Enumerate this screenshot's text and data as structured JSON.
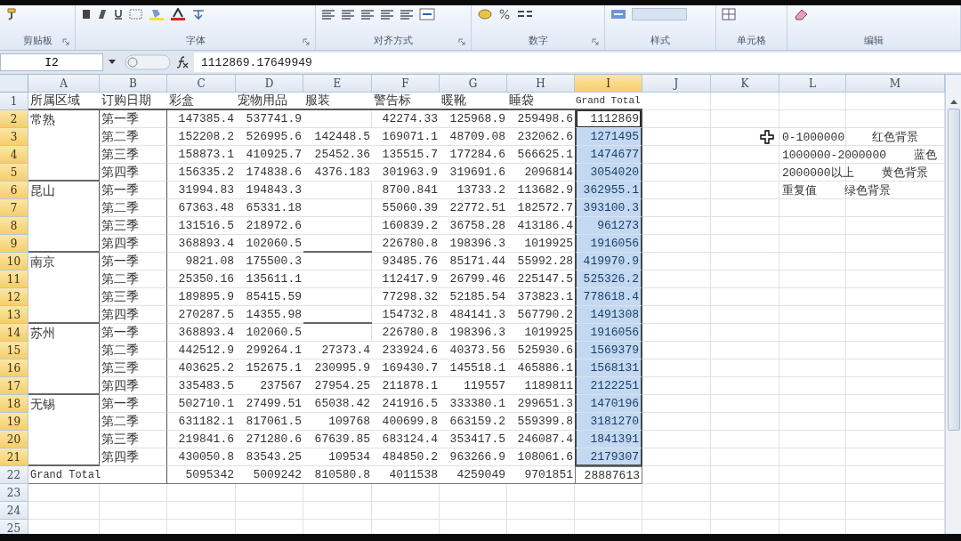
{
  "ribbon": {
    "groups": [
      {
        "label": "剪贴板",
        "dialog_launcher": true
      },
      {
        "label": "字体",
        "dialog_launcher": true
      },
      {
        "label": "对齐方式",
        "dialog_launcher": true
      },
      {
        "label": "数字",
        "dialog_launcher": true
      },
      {
        "label": "样式",
        "dialog_launcher": false
      },
      {
        "label": "单元格",
        "dialog_launcher": false
      },
      {
        "label": "编辑",
        "dialog_launcher": false
      }
    ]
  },
  "formula_bar": {
    "name_box": "I2",
    "formula": "1112869.17649949"
  },
  "sheet": {
    "column_headers": [
      {
        "label": "A",
        "selected": false
      },
      {
        "label": "B",
        "selected": false
      },
      {
        "label": "C",
        "selected": false
      },
      {
        "label": "D",
        "selected": false
      },
      {
        "label": "E",
        "selected": false
      },
      {
        "label": "F",
        "selected": false
      },
      {
        "label": "G",
        "selected": false
      },
      {
        "label": "H",
        "selected": false
      },
      {
        "label": "I",
        "selected": true
      },
      {
        "label": "J",
        "selected": false
      },
      {
        "label": "K",
        "selected": false
      },
      {
        "label": "L",
        "selected": false
      },
      {
        "label": "M",
        "selected": false
      }
    ],
    "row_headers": [
      {
        "label": "1",
        "selected": false
      },
      {
        "label": "2",
        "selected": true
      },
      {
        "label": "3",
        "selected": true
      },
      {
        "label": "4",
        "selected": true
      },
      {
        "label": "5",
        "selected": true
      },
      {
        "label": "6",
        "selected": true
      },
      {
        "label": "7",
        "selected": true
      },
      {
        "label": "8",
        "selected": true
      },
      {
        "label": "9",
        "selected": true
      },
      {
        "label": "10",
        "selected": true
      },
      {
        "label": "11",
        "selected": true
      },
      {
        "label": "12",
        "selected": true
      },
      {
        "label": "13",
        "selected": true
      },
      {
        "label": "14",
        "selected": true
      },
      {
        "label": "15",
        "selected": true
      },
      {
        "label": "16",
        "selected": true
      },
      {
        "label": "17",
        "selected": true
      },
      {
        "label": "18",
        "selected": true
      },
      {
        "label": "19",
        "selected": true
      },
      {
        "label": "20",
        "selected": true
      },
      {
        "label": "21",
        "selected": true
      },
      {
        "label": "22",
        "selected": false
      },
      {
        "label": "23",
        "selected": false
      },
      {
        "label": "24",
        "selected": false
      },
      {
        "label": "25",
        "selected": false
      }
    ],
    "pivot": {
      "headers": [
        "所属区域",
        "订购日期",
        "彩盒",
        "宠物用品",
        "服装",
        "警告标",
        "暖靴",
        "睡袋",
        "Grand Total"
      ],
      "groups": [
        {
          "region": "常熟",
          "quarters": [
            {
              "quarter": "第一季",
              "cells": {
                "C": "147385.4",
                "D": "537741.9",
                "F": "42274.33",
                "G": "125968.9",
                "H": "259498.6"
              },
              "total": "1112869",
              "selected": true,
              "active": true
            },
            {
              "quarter": "第二季",
              "cells": {
                "C": "152208.2",
                "D": "526995.6",
                "E": "142448.5",
                "F": "169071.1",
                "G": "48709.08",
                "H": "232062.6"
              },
              "total": "1271495",
              "selected": true,
              "active": false
            },
            {
              "quarter": "第三季",
              "cells": {
                "C": "158873.1",
                "D": "410925.7",
                "E": "25452.36",
                "F": "135515.7",
                "G": "177284.6",
                "H": "566625.1"
              },
              "total": "1474677",
              "selected": true,
              "active": false
            },
            {
              "quarter": "第四季",
              "cells": {
                "C": "156335.2",
                "D": "174838.6",
                "E": "4376.183",
                "F": "301963.9",
                "G": "319691.6",
                "H": "2096814"
              },
              "total": "3054020",
              "selected": true,
              "active": false
            }
          ]
        },
        {
          "region": "昆山",
          "quarters": [
            {
              "quarter": "第一季",
              "cells": {
                "C": "31994.83",
                "D": "194843.3",
                "F": "8700.841",
                "G": "13733.2",
                "H": "113682.9"
              },
              "total": "362955.1",
              "selected": true,
              "active": false
            },
            {
              "quarter": "第二季",
              "cells": {
                "C": "67363.48",
                "D": "65331.18",
                "F": "55060.39",
                "G": "22772.51",
                "H": "182572.7"
              },
              "total": "393100.3",
              "selected": true,
              "active": false
            },
            {
              "quarter": "第三季",
              "cells": {
                "C": "131516.5",
                "D": "218972.6",
                "F": "160839.2",
                "G": "36758.28",
                "H": "413186.4"
              },
              "total": "961273",
              "selected": true,
              "active": false
            },
            {
              "quarter": "第四季",
              "cells": {
                "C": "368893.4",
                "D": "102060.5",
                "F": "226780.8",
                "G": "198396.3",
                "H": "1019925"
              },
              "total": "1916056",
              "selected": true,
              "active": false
            }
          ]
        },
        {
          "region": "南京",
          "quarters": [
            {
              "quarter": "第一季",
              "cells": {
                "C": "9821.08",
                "D": "175500.3",
                "F": "93485.76",
                "G": "85171.44",
                "H": "55992.28"
              },
              "total": "419970.9",
              "selected": true,
              "active": false
            },
            {
              "quarter": "第二季",
              "cells": {
                "C": "25350.16",
                "D": "135611.1",
                "F": "112417.9",
                "G": "26799.46",
                "H": "225147.5"
              },
              "total": "525326.2",
              "selected": true,
              "active": false
            },
            {
              "quarter": "第三季",
              "cells": {
                "C": "189895.9",
                "D": "85415.59",
                "F": "77298.32",
                "G": "52185.54",
                "H": "373823.1"
              },
              "total": "778618.4",
              "selected": true,
              "active": false
            },
            {
              "quarter": "第四季",
              "cells": {
                "C": "270287.5",
                "D": "14355.98",
                "F": "154732.8",
                "G": "484141.3",
                "H": "567790.2"
              },
              "total": "1491308",
              "selected": true,
              "active": false
            }
          ]
        },
        {
          "region": "苏州",
          "quarters": [
            {
              "quarter": "第一季",
              "cells": {
                "C": "368893.4",
                "D": "102060.5",
                "F": "226780.8",
                "G": "198396.3",
                "H": "1019925"
              },
              "total": "1916056",
              "selected": true,
              "active": false
            },
            {
              "quarter": "第二季",
              "cells": {
                "C": "442512.9",
                "D": "299264.1",
                "E": "27373.4",
                "F": "233924.6",
                "G": "40373.56",
                "H": "525930.6"
              },
              "total": "1569379",
              "selected": true,
              "active": false
            },
            {
              "quarter": "第三季",
              "cells": {
                "C": "403625.2",
                "D": "152675.1",
                "E": "230995.9",
                "F": "169430.7",
                "G": "145518.1",
                "H": "465886.1"
              },
              "total": "1568131",
              "selected": true,
              "active": false
            },
            {
              "quarter": "第四季",
              "cells": {
                "C": "335483.5",
                "D": "237567",
                "E": "27954.25",
                "F": "211878.1",
                "G": "119557",
                "H": "1189811"
              },
              "total": "2122251",
              "selected": true,
              "active": false
            }
          ]
        },
        {
          "region": "无锡",
          "quarters": [
            {
              "quarter": "第一季",
              "cells": {
                "C": "502710.1",
                "D": "27499.51",
                "E": "65038.42",
                "F": "241916.5",
                "G": "333380.1",
                "H": "299651.3"
              },
              "total": "1470196",
              "selected": true,
              "active": false
            },
            {
              "quarter": "第二季",
              "cells": {
                "C": "631182.1",
                "D": "817061.5",
                "E": "109768",
                "F": "400699.8",
                "G": "663159.2",
                "H": "559399.8"
              },
              "total": "3181270",
              "selected": true,
              "active": false
            },
            {
              "quarter": "第三季",
              "cells": {
                "C": "219841.6",
                "D": "271280.6",
                "E": "67639.85",
                "F": "683124.4",
                "G": "353417.5",
                "H": "246087.4"
              },
              "total": "1841391",
              "selected": true,
              "active": false
            },
            {
              "quarter": "第四季",
              "cells": {
                "C": "430050.8",
                "D": "83543.25",
                "E": "109534",
                "F": "484850.2",
                "G": "963266.9",
                "H": "108061.6"
              },
              "total": "2179307",
              "selected": true,
              "active": false
            }
          ]
        }
      ],
      "grand_total": {
        "label": "Grand Total",
        "cells": {
          "C": "5095342",
          "D": "5009242",
          "E": "810580.8",
          "F": "4011538",
          "G": "4259049",
          "H": "9701851"
        },
        "total": "28887613"
      }
    },
    "notes": [
      "0-1000000    红色背景",
      "1000000-2000000    蓝色",
      "2000000以上    黄色背景",
      "重复值    绿色背景"
    ]
  }
}
